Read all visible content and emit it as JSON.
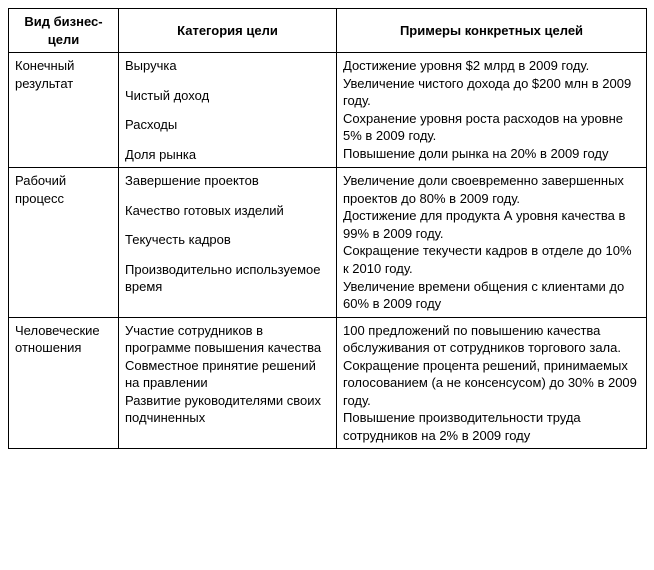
{
  "headers": {
    "col1": "Вид бизнес-цели",
    "col2": "Категория цели",
    "col3": "Примеры конкретных целей"
  },
  "rows": [
    {
      "kind": "Конечный результат",
      "categories": [
        "Выручка",
        "Чистый доход",
        "Расходы",
        "Доля рынка"
      ],
      "examples": [
        "Достижение уровня $2 млрд в 2009 году.",
        "Увеличение чистого дохода до $200 млн в 2009 году.",
        "Сохранение уровня роста расходов на уровне 5% в 2009 году.",
        "Повышение доли рынка на 20% в 2009 году"
      ]
    },
    {
      "kind": "Рабочий процесс",
      "categories": [
        "Завершение проектов",
        "Качество готовых изделий",
        "Текучесть кадров",
        "Производительно используемое время"
      ],
      "examples": [
        "Увеличение доли своевременно завершенных проектов до 80% в 2009 году.",
        "Достижение для продукта А уровня качества в 99% в 2009 году.",
        "Сокращение текучести кадров в отделе до 10% к 2010 году.",
        "Увеличение времени общения с клиентами до 60% в 2009 году"
      ]
    },
    {
      "kind": "Человеческие отношения",
      "categories": [
        "Участие сотрудников в программе повышения качества",
        "Совместное принятие решений на правлении",
        "Развитие руководителями своих подчиненных"
      ],
      "examples": [
        "100 предложений по повышению качества обслуживания от сотрудников торгового зала.",
        "Сокращение процента решений, принимаемых голосованием (а не консенсусом) до 30% в 2009 году.",
        "Повышение производительности труда сотрудников на 2% в 2009 году"
      ],
      "tight": true
    }
  ],
  "chart_data": {
    "type": "table",
    "columns": [
      "Вид бизнес-цели",
      "Категория цели",
      "Примеры конкретных целей"
    ],
    "data": [
      [
        "Конечный результат",
        "Выручка",
        "Достижение уровня $2 млрд в 2009 году."
      ],
      [
        "Конечный результат",
        "Чистый доход",
        "Увеличение чистого дохода до $200 млн в 2009 году."
      ],
      [
        "Конечный результат",
        "Расходы",
        "Сохранение уровня роста расходов на уровне 5% в 2009 году."
      ],
      [
        "Конечный результат",
        "Доля рынка",
        "Повышение доли рынка на 20% в 2009 году"
      ],
      [
        "Рабочий процесс",
        "Завершение проектов",
        "Увеличение доли своевременно завершенных проектов до 80% в 2009 году."
      ],
      [
        "Рабочий процесс",
        "Качество готовых изделий",
        "Достижение для продукта А уровня качества в 99% в 2009 году."
      ],
      [
        "Рабочий процесс",
        "Текучесть кадров",
        "Сокращение текучести кадров в отделе до 10% к 2010 году."
      ],
      [
        "Рабочий процесс",
        "Производительно используемое время",
        "Увеличение времени общения с клиентами до 60% в 2009 году"
      ],
      [
        "Человеческие отношения",
        "Участие сотрудников в программе повышения качества",
        "100 предложений по повышению качества обслуживания от сотрудников торгового зала."
      ],
      [
        "Человеческие отношения",
        "Совместное принятие решений на правлении",
        "Сокращение процента решений, принимаемых голосованием (а не консенсусом) до 30% в 2009 году."
      ],
      [
        "Человеческие отношения",
        "Развитие руководителями своих подчиненных",
        "Повышение производительности труда сотрудников на 2% в 2009 году"
      ]
    ]
  }
}
